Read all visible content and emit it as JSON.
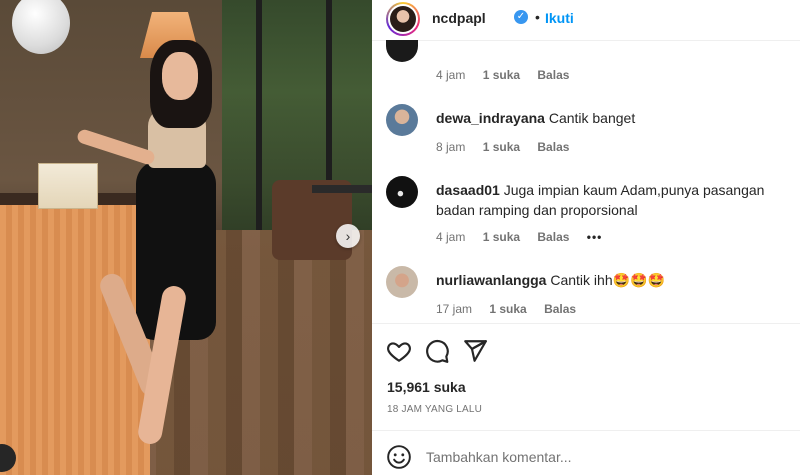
{
  "post": {
    "username": "ncdpapl",
    "dot": "•",
    "follow_label": "Ikuti",
    "verified_glyph": "✓",
    "next_glyph": "›"
  },
  "comments": [
    {
      "username": "",
      "text": "",
      "time": "4 jam",
      "likes": "1 suka",
      "reply": "Balas",
      "more": "",
      "avatar_color": "#1a1a1a"
    },
    {
      "username": "dewa_indrayana",
      "text": "Cantik banget",
      "time": "8 jam",
      "likes": "1 suka",
      "reply": "Balas",
      "more": "",
      "avatar_color": "#4a6a8a"
    },
    {
      "username": "dasaad01",
      "text": "Juga impian kaum Adam,punya pasangan badan ramping dan proporsional",
      "time": "4 jam",
      "likes": "1 suka",
      "reply": "Balas",
      "more": "•••",
      "avatar_color": "#111111"
    },
    {
      "username": "nurliawanlangga",
      "text": "Cantik ihh🤩🤩🤩",
      "time": "17 jam",
      "likes": "1 suka",
      "reply": "Balas",
      "more": "",
      "avatar_color": "#c7b7a6"
    }
  ],
  "actions": {
    "like_icon": "heart-icon",
    "comment_icon": "comment-icon",
    "share_icon": "share-icon"
  },
  "likes_label": "15,961 suka",
  "time_ago": "18 JAM YANG LALU",
  "add_comment": {
    "placeholder": "Tambahkan komentar..."
  }
}
